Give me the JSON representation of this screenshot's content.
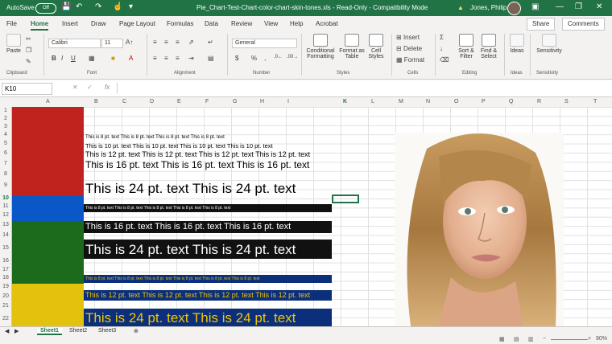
{
  "titlebar": {
    "autosave": "AutoSave",
    "autosave_state": "Off",
    "doc_title": "Pie_Chart-Test-Chart-color-chart-skin-tones.xls  -  Read-Only  -  Compatibility Mode",
    "user": "Jones, Philip"
  },
  "tabs": [
    "File",
    "Home",
    "Insert",
    "Draw",
    "Page Layout",
    "Formulas",
    "Data",
    "Review",
    "View",
    "Help",
    "Acrobat"
  ],
  "share_label": "Share",
  "comments_label": "Comments",
  "ribbon": {
    "paste": "Paste",
    "font_name": "Calibri",
    "font_size": "11",
    "number_format": "General",
    "groups": [
      "Clipboard",
      "Font",
      "Alignment",
      "Number",
      "Styles",
      "Cells",
      "Editing",
      "Ideas",
      "Sensitivity"
    ],
    "conditional": "Conditional Formatting",
    "format_table": "Format as Table",
    "cell_styles": "Cell Styles",
    "insert": "Insert",
    "delete": "Delete",
    "format": "Format",
    "sort_filter": "Sort & Filter",
    "find_select": "Find & Select",
    "ideas": "Ideas",
    "sensitivity": "Sensitivity"
  },
  "formula_bar": {
    "name_box": "K10",
    "fx": "fx",
    "content": ""
  },
  "columns": [
    "A",
    "B",
    "C",
    "D",
    "E",
    "F",
    "G",
    "H",
    "I",
    "K",
    "L",
    "M",
    "N",
    "O",
    "P",
    "Q",
    "R",
    "S",
    "T"
  ],
  "rows": [
    "1",
    "2",
    "3",
    "4",
    "5",
    "6",
    "7",
    "8",
    "9",
    "10",
    "11",
    "12",
    "13",
    "14",
    "15",
    "16",
    "17",
    "18",
    "19",
    "20",
    "21",
    "22"
  ],
  "selected_cell": {
    "column": "K",
    "row": "10"
  },
  "swatches": [
    {
      "name": "red",
      "color": "#c0221d"
    },
    {
      "name": "blue",
      "color": "#0a58c8"
    },
    {
      "name": "green",
      "color": "#1c6b1c"
    },
    {
      "name": "yellow",
      "color": "#e3c20d"
    }
  ],
  "text_rows": {
    "r4": "This is 8 pt. text   This is 8 pt. text   This is 8 pt. text   This is 8 pt. text",
    "r5": "This is 10 pt. text   This is 10 pt. text   This is 10 pt. text   This is 10 pt. text",
    "r6": "This is 12 pt. text   This is 12 pt. text   This is 12 pt. text   This is 12 pt. text",
    "r7": "This is 16 pt. text   This is 16 pt. text   This is 16 pt. text",
    "r9": "This is 24 pt. text   This is 24 pt. text",
    "r11": "This is 8 pt. text   This is 8 pt. text   This is 8 pt. text   This is 8 pt. text   This is 8 pt. text",
    "r13": "This is 16 pt. text   This is 16 pt. text   This is 16 pt. text",
    "r15": "This is 24 pt. text   This is 24 pt. text",
    "r18": "This is 8 pt. text   This is 8 pt. text   This is 8 pt. text   This is 8 pt. text   This is 8 pt. text   This is 8 pt. text",
    "r20": "This is 12 pt. text   This is 12 pt. text   This is 12 pt. text   This is 12 pt. text",
    "r22": "This is 24 pt. text   This is 24 pt. text"
  },
  "band_colors": {
    "black": "#111111",
    "navy": "#0b2f7a",
    "text_white": "#ffffff",
    "text_yellow": "#f2c400"
  },
  "sheets": [
    "Sheet1",
    "Sheet2",
    "Sheet3"
  ],
  "active_sheet": "Sheet1",
  "zoom": "90%"
}
